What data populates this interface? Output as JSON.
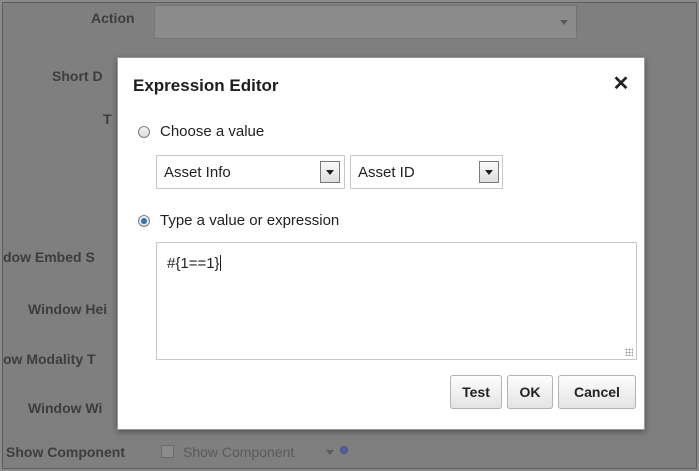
{
  "background_form": {
    "labels": {
      "action": "Action",
      "short_desc": "Short D",
      "t": "T",
      "window_embed": "dow Embed S",
      "window_height": "Window Hei",
      "window_modality": "ow Modality T",
      "window_width": "Window Wi",
      "show_component": "Show Component"
    },
    "show_component_checkbox_label": "Show Component"
  },
  "dialog": {
    "title": "Expression Editor",
    "close_glyph": "✕",
    "choose_value_label": "Choose a value",
    "select_category": "Asset Info",
    "select_attribute": "Asset ID",
    "type_value_label": "Type a value or expression",
    "expression": "#{1==1}",
    "buttons": {
      "test": "Test",
      "ok": "OK",
      "cancel": "Cancel"
    },
    "selected_option": "type_value"
  }
}
